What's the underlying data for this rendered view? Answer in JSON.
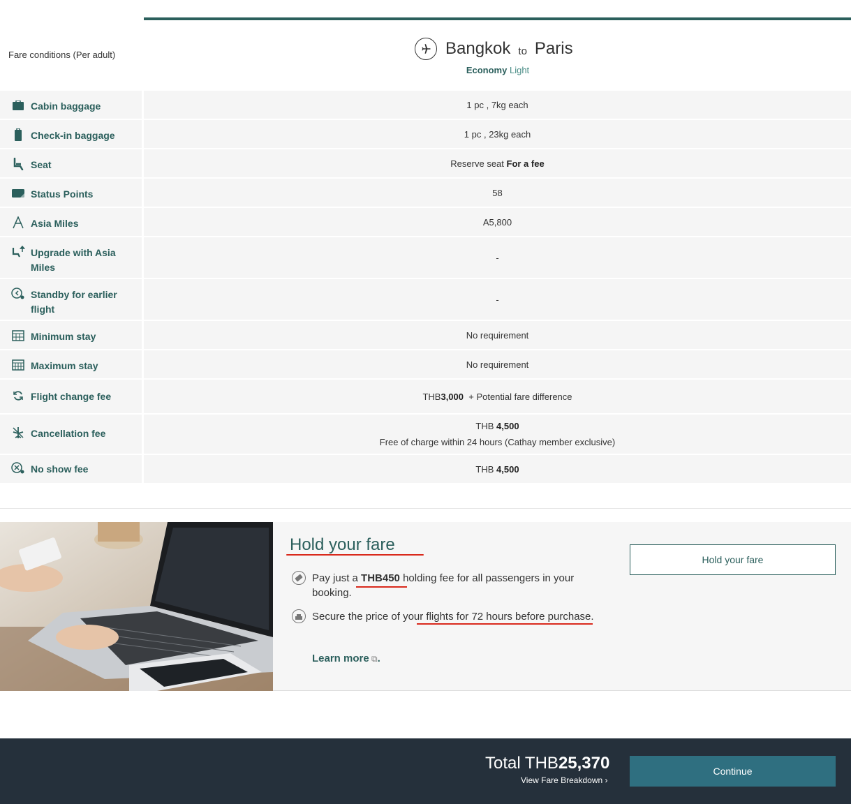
{
  "header": {
    "fare_conditions_label": "Fare conditions (Per adult)",
    "origin": "Bangkok",
    "to_word": "to",
    "destination": "Paris",
    "cabin_class": "Economy",
    "fare_type": "Light"
  },
  "conditions": [
    {
      "icon": "cabin-baggage-icon",
      "label": "Cabin baggage",
      "value": "1 pc , 7kg each"
    },
    {
      "icon": "checkin-baggage-icon",
      "label": "Check-in baggage",
      "value": "1 pc , 23kg each"
    },
    {
      "icon": "seat-icon",
      "label": "Seat",
      "value_prefix": "Reserve seat ",
      "value_bold": "For a fee"
    },
    {
      "icon": "status-points-icon",
      "label": "Status Points",
      "value": "58"
    },
    {
      "icon": "asia-miles-icon",
      "label": "Asia Miles",
      "value": "A5,800"
    },
    {
      "icon": "upgrade-icon",
      "label": "Upgrade with Asia Miles",
      "value": "-"
    },
    {
      "icon": "standby-icon",
      "label": "Standby for earlier flight",
      "value": "-"
    },
    {
      "icon": "calendar-min-icon",
      "label": "Minimum stay",
      "value": "No requirement"
    },
    {
      "icon": "calendar-max-icon",
      "label": "Maximum stay",
      "value": "No requirement"
    },
    {
      "icon": "change-icon",
      "label": "Flight change fee",
      "value_prefix": "THB",
      "value_bold": "3,000",
      "value_suffix": "  + Potential fare difference"
    },
    {
      "icon": "cancel-icon",
      "label": "Cancellation fee",
      "value_prefix": "THB ",
      "value_bold": "4,500",
      "value_line2": "Free of charge within 24 hours (Cathay member exclusive)"
    },
    {
      "icon": "no-show-icon",
      "label": "No show fee",
      "value_prefix": "THB ",
      "value_bold": "4,500"
    }
  ],
  "hold": {
    "title": "Hold your fare",
    "item1_prefix": "Pay just a ",
    "item1_bold": "THB450",
    "item1_suffix": " holding fee for all passengers in your booking.",
    "item2": "Secure the price of your flights for 72 hours before purchase.",
    "learn_more": "Learn more",
    "button": "Hold your fare"
  },
  "footer": {
    "total_label": "Total THB",
    "total_amount": "25,370",
    "breakdown": "View Fare Breakdown",
    "continue": "Continue"
  },
  "colors": {
    "accent": "#2b5f5c",
    "footer_bg": "#25303b",
    "continue_bg": "#2f6f80",
    "annotation_red": "#d9291c"
  }
}
